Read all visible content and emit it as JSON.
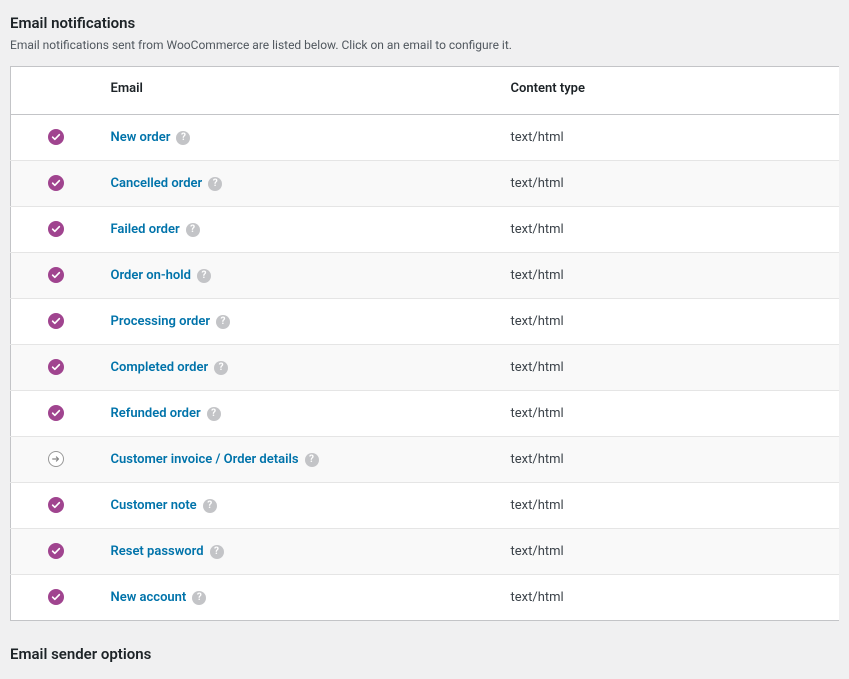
{
  "section": {
    "title": "Email notifications",
    "description": "Email notifications sent from WooCommerce are listed below. Click on an email to configure it."
  },
  "table": {
    "headers": {
      "status": "",
      "email": "Email",
      "content_type": "Content type"
    }
  },
  "emails": [
    {
      "name": "New order",
      "status": "enabled",
      "content_type": "text/html"
    },
    {
      "name": "Cancelled order",
      "status": "enabled",
      "content_type": "text/html"
    },
    {
      "name": "Failed order",
      "status": "enabled",
      "content_type": "text/html"
    },
    {
      "name": "Order on-hold",
      "status": "enabled",
      "content_type": "text/html"
    },
    {
      "name": "Processing order",
      "status": "enabled",
      "content_type": "text/html"
    },
    {
      "name": "Completed order",
      "status": "enabled",
      "content_type": "text/html"
    },
    {
      "name": "Refunded order",
      "status": "enabled",
      "content_type": "text/html"
    },
    {
      "name": "Customer invoice / Order details",
      "status": "manual",
      "content_type": "text/html"
    },
    {
      "name": "Customer note",
      "status": "enabled",
      "content_type": "text/html"
    },
    {
      "name": "Reset password",
      "status": "enabled",
      "content_type": "text/html"
    },
    {
      "name": "New account",
      "status": "enabled",
      "content_type": "text/html"
    }
  ],
  "next_section": {
    "title": "Email sender options"
  },
  "help_tip_glyph": "?"
}
